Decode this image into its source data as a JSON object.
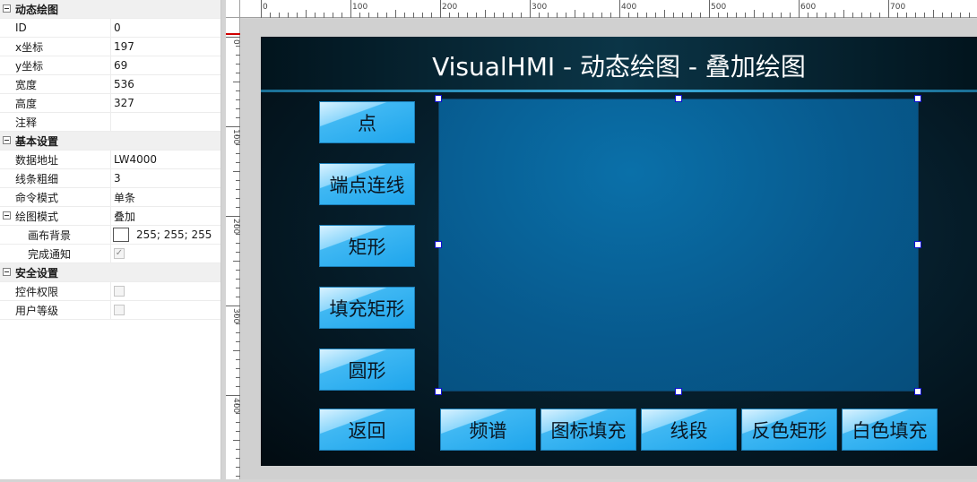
{
  "props": {
    "cat_dynamic": "动态绘图",
    "rows_dynamic": [
      {
        "name": "ID",
        "value": "0"
      },
      {
        "name": "x坐标",
        "value": "197"
      },
      {
        "name": "y坐标",
        "value": "69"
      },
      {
        "name": "宽度",
        "value": "536"
      },
      {
        "name": "高度",
        "value": "327"
      },
      {
        "name": "注释",
        "value": ""
      }
    ],
    "cat_basic": "基本设置",
    "rows_basic": [
      {
        "name": "数据地址",
        "value": "LW4000"
      },
      {
        "name": "线条粗细",
        "value": "3"
      },
      {
        "name": "命令模式",
        "value": "单条"
      }
    ],
    "draw_mode": {
      "name": "绘图模式",
      "value": "叠加"
    },
    "canvas_bg": {
      "name": "画布背景",
      "value": "255; 255; 255",
      "color": "#ffffff"
    },
    "done_notify": {
      "name": "完成通知",
      "check": "✓"
    },
    "cat_security": "安全设置",
    "rows_security": [
      {
        "name": "控件权限"
      },
      {
        "name": "用户等级"
      }
    ]
  },
  "ruler": {
    "top": [
      "0",
      "100",
      "200",
      "300",
      "400",
      "500",
      "600",
      "700"
    ],
    "left": [
      "0",
      "100",
      "200",
      "300",
      "400"
    ]
  },
  "screen": {
    "title": "VisualHMI - 动态绘图 - 叠加绘图",
    "left_buttons": [
      "点",
      "端点连线",
      "矩形",
      "填充矩形",
      "圆形",
      "返回"
    ],
    "bottom_buttons": [
      "频谱",
      "图标填充",
      "线段",
      "反色矩形",
      "白色填充"
    ]
  },
  "colors": {
    "button_blue": "#1ea5ec",
    "draw_area": "#075a8e",
    "handle_border": "#1010d0"
  }
}
